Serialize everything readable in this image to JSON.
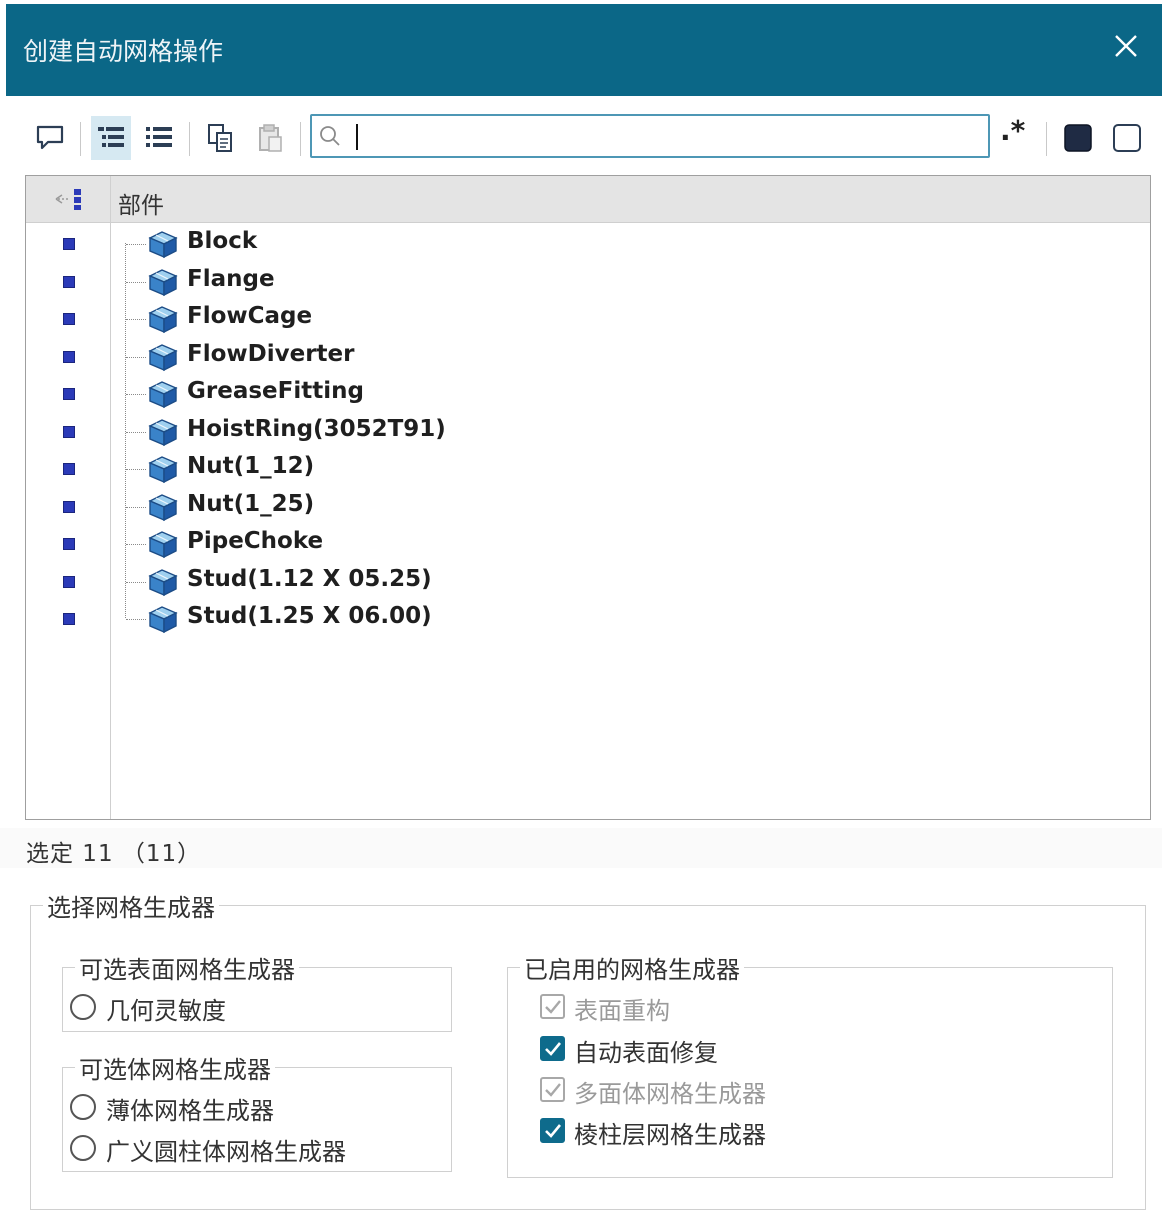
{
  "dialog": {
    "title": "创建自动网格操作",
    "close_icon": "close-icon"
  },
  "toolbar": {
    "search_value": "",
    "regex_label": ".*",
    "buttons": [
      "comment-icon",
      "tree-view-icon",
      "list-view-icon",
      "copy-icon",
      "paste-icon",
      "select-all-icon",
      "select-none-icon"
    ]
  },
  "tree": {
    "header": "部件",
    "parts": [
      "Block",
      "Flange",
      "FlowCage",
      "FlowDiverter",
      "GreaseFitting",
      "HoistRing(3052T91)",
      "Nut(1_12)",
      "Nut(1_25)",
      "PipeChoke",
      "Stud(1.12 X 05.25)",
      "Stud(1.25 X 06.00)"
    ]
  },
  "status": {
    "selection_text": "选定 11 （11）"
  },
  "mesher_group": {
    "title": "选择网格生成器",
    "optional_surface": {
      "title": "可选表面网格生成器",
      "options": [
        "几何灵敏度"
      ]
    },
    "optional_volume": {
      "title": "可选体网格生成器",
      "options": [
        "薄体网格生成器",
        "广义圆柱体网格生成器"
      ]
    },
    "enabled": {
      "title": "已启用的网格生成器",
      "items": [
        {
          "label": "表面重构",
          "checked": true,
          "disabled": true
        },
        {
          "label": "自动表面修复",
          "checked": true,
          "disabled": false
        },
        {
          "label": "多面体网格生成器",
          "checked": true,
          "disabled": true
        },
        {
          "label": "棱柱层网格生成器",
          "checked": true,
          "disabled": false
        }
      ]
    }
  },
  "colors": {
    "titlebar": "#0b6787",
    "checkbox": "#0e6b8c",
    "selection_marker": "#2b3ab8"
  }
}
